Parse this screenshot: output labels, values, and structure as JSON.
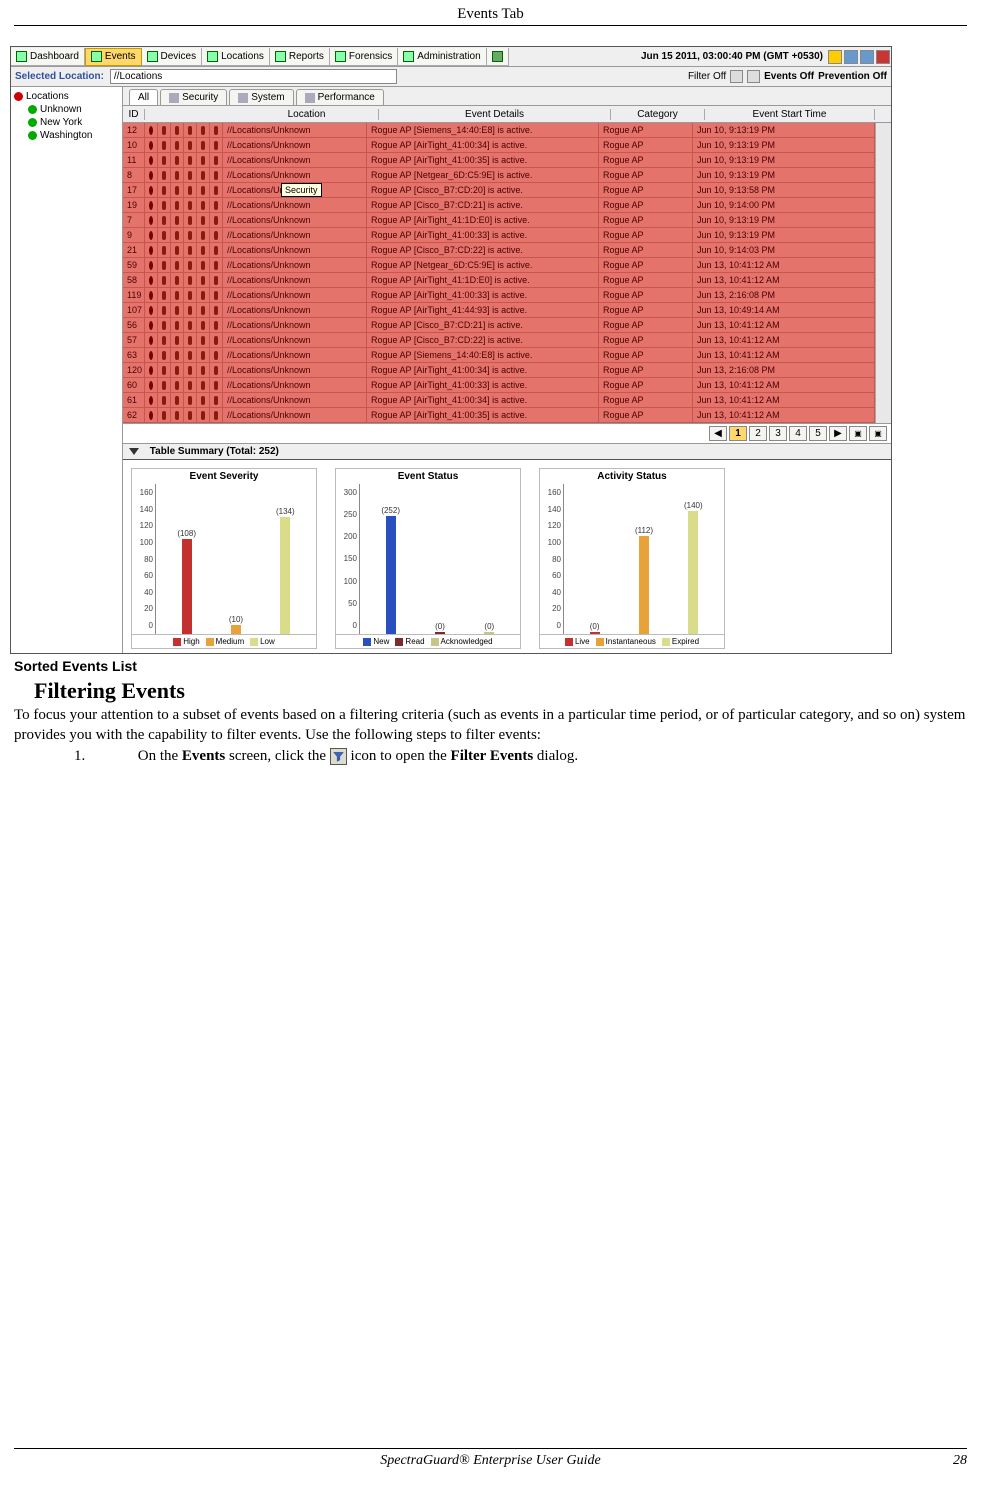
{
  "page": {
    "header_title": "Events Tab",
    "footer_text": "SpectraGuard® Enterprise User Guide",
    "page_number": "28"
  },
  "screenshot": {
    "toolbar": {
      "tabs": [
        "Dashboard",
        "Events",
        "Devices",
        "Locations",
        "Reports",
        "Forensics",
        "Administration"
      ],
      "active_tab_index": 1,
      "datetime": "Jun 15 2011, 03:00:40 PM (GMT +0530)"
    },
    "secondbar": {
      "location_label": "Selected Location:",
      "location_value": "//Locations",
      "filter_text": "Filter Off",
      "events_text": "Events Off",
      "prevention_text": "Prevention Off"
    },
    "tree": {
      "root": "Locations",
      "children": [
        "Unknown",
        "New York",
        "Washington"
      ]
    },
    "subtabs": [
      "All",
      "Security",
      "System",
      "Performance"
    ],
    "subtabs_active": 0,
    "grid": {
      "headers": [
        "ID",
        "",
        "",
        "",
        "",
        "",
        "",
        "Location",
        "Event Details",
        "Category",
        "Event Start Time"
      ],
      "rows": [
        {
          "id": "12",
          "loc": "//Locations/Unknown",
          "det": "Rogue AP [Siemens_14:40:E8] is active.",
          "cat": "Rogue AP",
          "time": "Jun 10, 9:13:19 PM"
        },
        {
          "id": "10",
          "loc": "//Locations/Unknown",
          "det": "Rogue AP [AirTight_41:00:34] is active.",
          "cat": "Rogue AP",
          "time": "Jun 10, 9:13:19 PM"
        },
        {
          "id": "11",
          "loc": "//Locations/Unknown",
          "det": "Rogue AP [AirTight_41:00:35] is active.",
          "cat": "Rogue AP",
          "time": "Jun 10, 9:13:19 PM"
        },
        {
          "id": "8",
          "loc": "//Locations/Unknown",
          "det": "Rogue AP [Netgear_6D:C5:9E] is active.",
          "cat": "Rogue AP",
          "time": "Jun 10, 9:13:19 PM"
        },
        {
          "id": "17",
          "loc": "//Locations/Unknown",
          "det": "Rogue AP [Cisco_B7:CD:20] is active.",
          "cat": "Rogue AP",
          "time": "Jun 10, 9:13:58 PM"
        },
        {
          "id": "19",
          "loc": "//Locations/Unknown",
          "det": "Rogue AP [Cisco_B7:CD:21] is active.",
          "cat": "Rogue AP",
          "time": "Jun 10, 9:14:00 PM"
        },
        {
          "id": "7",
          "loc": "//Locations/Unknown",
          "det": "Rogue AP [AirTight_41:1D:E0] is active.",
          "cat": "Rogue AP",
          "time": "Jun 10, 9:13:19 PM"
        },
        {
          "id": "9",
          "loc": "//Locations/Unknown",
          "det": "Rogue AP [AirTight_41:00:33] is active.",
          "cat": "Rogue AP",
          "time": "Jun 10, 9:13:19 PM"
        },
        {
          "id": "21",
          "loc": "//Locations/Unknown",
          "det": "Rogue AP [Cisco_B7:CD:22] is active.",
          "cat": "Rogue AP",
          "time": "Jun 10, 9:14:03 PM"
        },
        {
          "id": "59",
          "loc": "//Locations/Unknown",
          "det": "Rogue AP [Netgear_6D:C5:9E] is active.",
          "cat": "Rogue AP",
          "time": "Jun 13, 10:41:12 AM"
        },
        {
          "id": "58",
          "loc": "//Locations/Unknown",
          "det": "Rogue AP [AirTight_41:1D:E0] is active.",
          "cat": "Rogue AP",
          "time": "Jun 13, 10:41:12 AM"
        },
        {
          "id": "119",
          "loc": "//Locations/Unknown",
          "det": "Rogue AP [AirTight_41:00:33] is active.",
          "cat": "Rogue AP",
          "time": "Jun 13, 2:16:08 PM"
        },
        {
          "id": "107",
          "loc": "//Locations/Unknown",
          "det": "Rogue AP [AirTight_41:44:93] is active.",
          "cat": "Rogue AP",
          "time": "Jun 13, 10:49:14 AM"
        },
        {
          "id": "56",
          "loc": "//Locations/Unknown",
          "det": "Rogue AP [Cisco_B7:CD:21] is active.",
          "cat": "Rogue AP",
          "time": "Jun 13, 10:41:12 AM"
        },
        {
          "id": "57",
          "loc": "//Locations/Unknown",
          "det": "Rogue AP [Cisco_B7:CD:22] is active.",
          "cat": "Rogue AP",
          "time": "Jun 13, 10:41:12 AM"
        },
        {
          "id": "63",
          "loc": "//Locations/Unknown",
          "det": "Rogue AP [Siemens_14:40:E8] is active.",
          "cat": "Rogue AP",
          "time": "Jun 13, 10:41:12 AM"
        },
        {
          "id": "120",
          "loc": "//Locations/Unknown",
          "det": "Rogue AP [AirTight_41:00:34] is active.",
          "cat": "Rogue AP",
          "time": "Jun 13, 2:16:08 PM"
        },
        {
          "id": "60",
          "loc": "//Locations/Unknown",
          "det": "Rogue AP [AirTight_41:00:33] is active.",
          "cat": "Rogue AP",
          "time": "Jun 13, 10:41:12 AM"
        },
        {
          "id": "61",
          "loc": "//Locations/Unknown",
          "det": "Rogue AP [AirTight_41:00:34] is active.",
          "cat": "Rogue AP",
          "time": "Jun 13, 10:41:12 AM"
        },
        {
          "id": "62",
          "loc": "//Locations/Unknown",
          "det": "Rogue AP [AirTight_41:00:35] is active.",
          "cat": "Rogue AP",
          "time": "Jun 13, 10:41:12 AM"
        }
      ],
      "tooltip": "Security"
    },
    "pager": {
      "pages": [
        "1",
        "2",
        "3",
        "4",
        "5"
      ],
      "current": 0
    },
    "summary_title": "Table Summary (Total: 252)"
  },
  "chart_data": [
    {
      "type": "bar",
      "title": "Event Severity",
      "categories": [
        "High",
        "Medium",
        "Low"
      ],
      "values": [
        108,
        10,
        134
      ],
      "value_labels": [
        "(108)",
        "(10)",
        "(134)"
      ],
      "colors": [
        "#c23030",
        "#e8a23a",
        "#d9dd8a"
      ],
      "ylim": [
        0,
        160
      ],
      "yticks": [
        0,
        20,
        40,
        60,
        80,
        100,
        120,
        140,
        160
      ],
      "legend": [
        "High",
        "Medium",
        "Low"
      ]
    },
    {
      "type": "bar",
      "title": "Event Status",
      "categories": [
        "New",
        "Read",
        "Acknowledged"
      ],
      "values": [
        252,
        0,
        0
      ],
      "value_labels": [
        "(252)",
        "(0)",
        "(0)"
      ],
      "colors": [
        "#2a4fbf",
        "#7f2a2a",
        "#c8c58a"
      ],
      "ylim": [
        0,
        300
      ],
      "yticks": [
        0,
        50,
        100,
        150,
        200,
        250,
        300
      ],
      "legend": [
        "New",
        "Read",
        "Acknowledged"
      ]
    },
    {
      "type": "bar",
      "title": "Activity Status",
      "categories": [
        "Live",
        "Instantaneous",
        "Expired"
      ],
      "values": [
        0,
        112,
        140
      ],
      "value_labels": [
        "(0)",
        "(112)",
        "(140)"
      ],
      "colors": [
        "#c23030",
        "#e8a23a",
        "#d9dd8a"
      ],
      "ylim": [
        0,
        160
      ],
      "yticks": [
        0,
        20,
        40,
        60,
        80,
        100,
        120,
        140,
        160
      ],
      "legend": [
        "Live",
        "Instantaneous",
        "Expired"
      ]
    }
  ],
  "doc": {
    "caption": "Sorted Events List",
    "section_title": "Filtering Events",
    "body_para": "To focus your attention to a subset of events based on a filtering criteria (such as events in a particular time period, or of particular category, and so on) system provides you with the capability to filter events. Use the following steps to filter events:",
    "step_num": "1.",
    "step_pre": "On the ",
    "step_bold1": "Events",
    "step_mid": " screen, click the ",
    "step_post": " icon to open the ",
    "step_bold2": "Filter Events",
    "step_end": " dialog."
  }
}
